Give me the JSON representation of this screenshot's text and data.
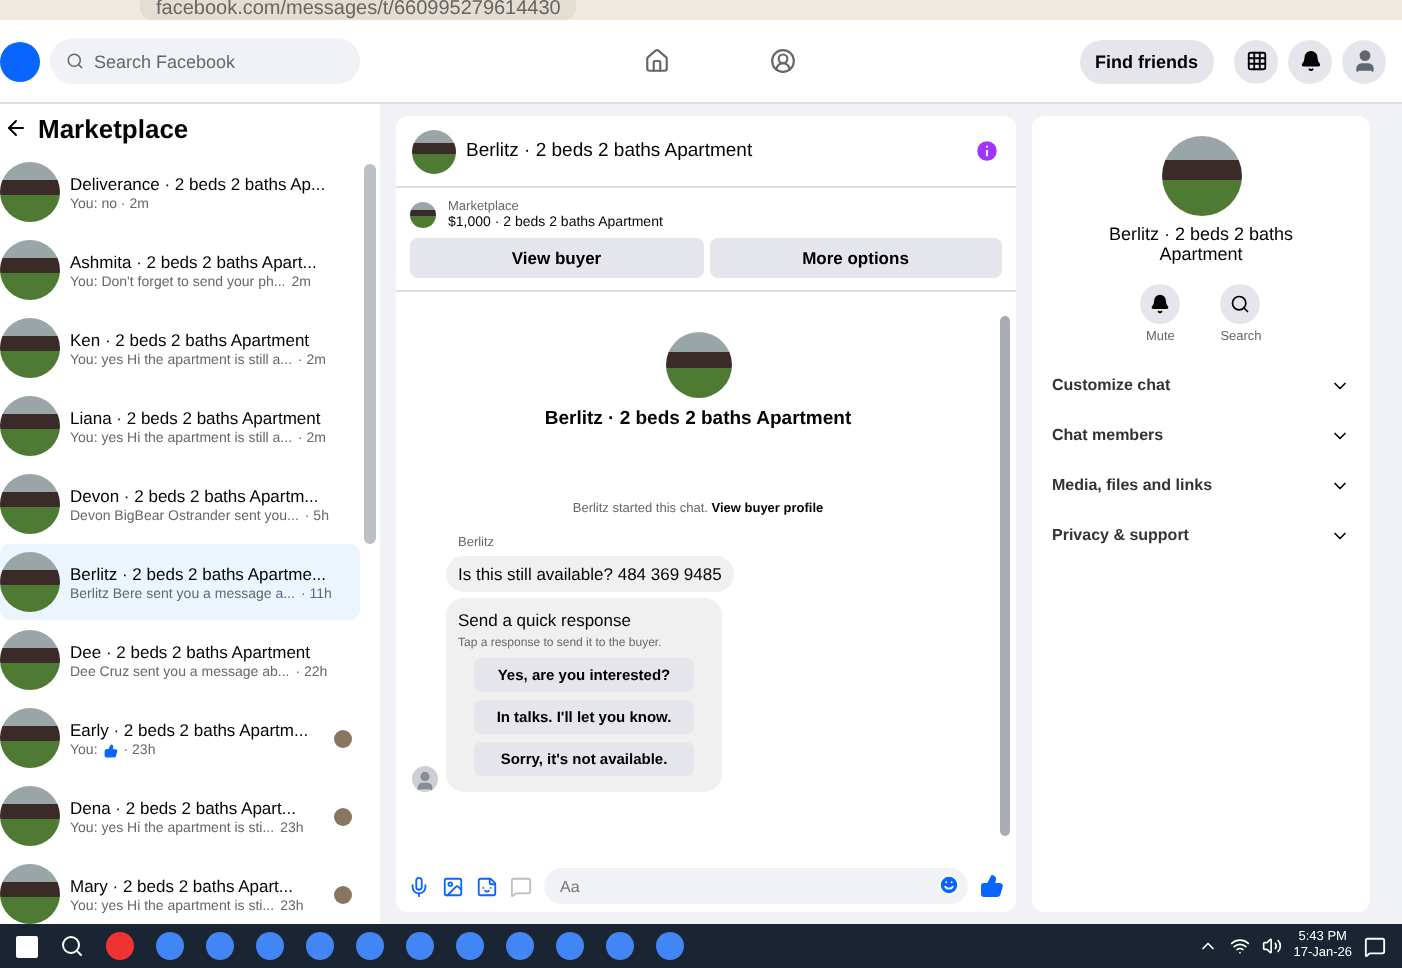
{
  "browser": {
    "url": "facebook.com/messages/t/660995279614430"
  },
  "header": {
    "search": {
      "placeholder": "Search Facebook"
    },
    "find_friends": "Find friends"
  },
  "sidebar": {
    "title": "Marketplace",
    "conversations": [
      {
        "name": "Deliverance · 2 beds 2 baths Ap...",
        "preview": "You: no · 2m",
        "selected": false,
        "seen_avatar": false
      },
      {
        "name": "Ashmita · 2 beds 2 baths Apart...",
        "preview": "You: Don't forget to send your ph...",
        "time": "2m",
        "selected": false,
        "seen_avatar": false
      },
      {
        "name": "Ken · 2 beds 2 baths Apartment",
        "preview": "You: yes Hi the apartment is still a...",
        "time": "· 2m",
        "selected": false,
        "seen_avatar": false
      },
      {
        "name": "Liana · 2 beds 2 baths Apartment",
        "preview": "You: yes Hi the apartment is still a...",
        "time": "· 2m",
        "selected": false,
        "seen_avatar": false
      },
      {
        "name": "Devon · 2 beds 2 baths Apartm...",
        "preview": "Devon BigBear Ostrander sent you...",
        "time": "· 5h",
        "selected": false,
        "seen_avatar": false
      },
      {
        "name": "Berlitz · 2 beds 2 baths Apartme...",
        "preview": "Berlitz Bere sent you a message a...",
        "time": "· 11h",
        "selected": true,
        "seen_avatar": false
      },
      {
        "name": "Dee · 2 beds 2 baths Apartment",
        "preview": "Dee Cruz sent you a message ab...",
        "time": "· 22h",
        "selected": false,
        "seen_avatar": false
      },
      {
        "name": "Early · 2 beds 2 baths Apartm...",
        "preview": "You:",
        "time": "· 23h",
        "selected": false,
        "seen_avatar": true,
        "like": true
      },
      {
        "name": "Dena · 2 beds 2 baths Apart...",
        "preview": "You: yes Hi the apartment is sti...",
        "time": "23h",
        "selected": false,
        "seen_avatar": true
      },
      {
        "name": "Mary · 2 beds 2 baths Apart...",
        "preview": "You: yes Hi the apartment is sti...",
        "time": "23h",
        "selected": false,
        "seen_avatar": true
      }
    ]
  },
  "chat": {
    "title": "Berlitz · 2 beds 2 baths Apartment",
    "listing": {
      "source": "Marketplace",
      "detail": "$1,000 · 2 beds 2 baths Apartment"
    },
    "buttons": [
      "View buyer",
      "More options"
    ],
    "intro_title": "Berlitz · 2 beds 2 baths Apartment",
    "started": "Berlitz started this chat.",
    "profile_link": "View buyer profile",
    "sender": "Berlitz",
    "message": "Is this still available? 484 369 9485",
    "quick": {
      "title": "Send a quick response",
      "hint": "Tap a response to send it to the buyer.",
      "responses": [
        "Yes, are you interested?",
        "In talks. I'll let you know.",
        "Sorry, it's not available."
      ]
    },
    "composer": {
      "placeholder": "Aa"
    }
  },
  "details": {
    "title": "Berlitz · 2 beds 2 baths Apartment",
    "actions": [
      {
        "kind": "mute",
        "label": "Mute"
      },
      {
        "kind": "search",
        "label": "Search"
      }
    ],
    "sections": [
      "Customize chat",
      "Chat members",
      "Media, files and links",
      "Privacy & support"
    ]
  },
  "taskbar": {
    "time": "5:43 PM",
    "date": "17-Jan-26"
  }
}
